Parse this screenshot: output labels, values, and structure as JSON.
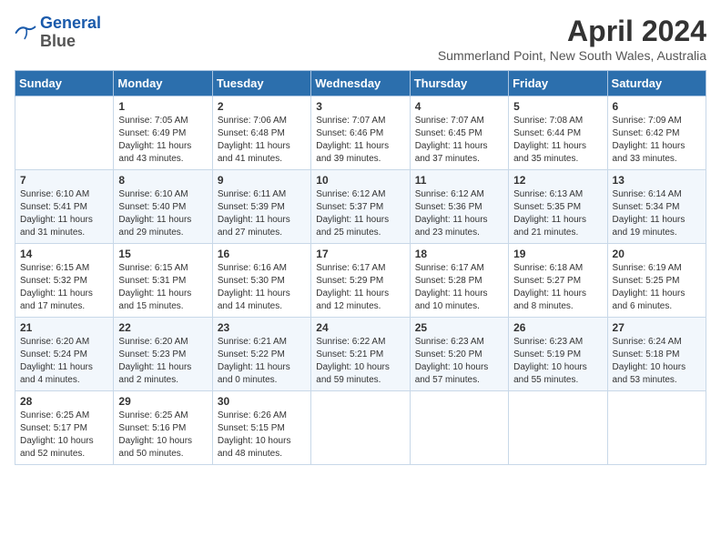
{
  "logo": {
    "line1": "General",
    "line2": "Blue"
  },
  "title": "April 2024",
  "location": "Summerland Point, New South Wales, Australia",
  "weekdays": [
    "Sunday",
    "Monday",
    "Tuesday",
    "Wednesday",
    "Thursday",
    "Friday",
    "Saturday"
  ],
  "weeks": [
    [
      {
        "day": "",
        "content": ""
      },
      {
        "day": "1",
        "content": "Sunrise: 7:05 AM\nSunset: 6:49 PM\nDaylight: 11 hours\nand 43 minutes."
      },
      {
        "day": "2",
        "content": "Sunrise: 7:06 AM\nSunset: 6:48 PM\nDaylight: 11 hours\nand 41 minutes."
      },
      {
        "day": "3",
        "content": "Sunrise: 7:07 AM\nSunset: 6:46 PM\nDaylight: 11 hours\nand 39 minutes."
      },
      {
        "day": "4",
        "content": "Sunrise: 7:07 AM\nSunset: 6:45 PM\nDaylight: 11 hours\nand 37 minutes."
      },
      {
        "day": "5",
        "content": "Sunrise: 7:08 AM\nSunset: 6:44 PM\nDaylight: 11 hours\nand 35 minutes."
      },
      {
        "day": "6",
        "content": "Sunrise: 7:09 AM\nSunset: 6:42 PM\nDaylight: 11 hours\nand 33 minutes."
      }
    ],
    [
      {
        "day": "7",
        "content": "Sunrise: 6:10 AM\nSunset: 5:41 PM\nDaylight: 11 hours\nand 31 minutes."
      },
      {
        "day": "8",
        "content": "Sunrise: 6:10 AM\nSunset: 5:40 PM\nDaylight: 11 hours\nand 29 minutes."
      },
      {
        "day": "9",
        "content": "Sunrise: 6:11 AM\nSunset: 5:39 PM\nDaylight: 11 hours\nand 27 minutes."
      },
      {
        "day": "10",
        "content": "Sunrise: 6:12 AM\nSunset: 5:37 PM\nDaylight: 11 hours\nand 25 minutes."
      },
      {
        "day": "11",
        "content": "Sunrise: 6:12 AM\nSunset: 5:36 PM\nDaylight: 11 hours\nand 23 minutes."
      },
      {
        "day": "12",
        "content": "Sunrise: 6:13 AM\nSunset: 5:35 PM\nDaylight: 11 hours\nand 21 minutes."
      },
      {
        "day": "13",
        "content": "Sunrise: 6:14 AM\nSunset: 5:34 PM\nDaylight: 11 hours\nand 19 minutes."
      }
    ],
    [
      {
        "day": "14",
        "content": "Sunrise: 6:15 AM\nSunset: 5:32 PM\nDaylight: 11 hours\nand 17 minutes."
      },
      {
        "day": "15",
        "content": "Sunrise: 6:15 AM\nSunset: 5:31 PM\nDaylight: 11 hours\nand 15 minutes."
      },
      {
        "day": "16",
        "content": "Sunrise: 6:16 AM\nSunset: 5:30 PM\nDaylight: 11 hours\nand 14 minutes."
      },
      {
        "day": "17",
        "content": "Sunrise: 6:17 AM\nSunset: 5:29 PM\nDaylight: 11 hours\nand 12 minutes."
      },
      {
        "day": "18",
        "content": "Sunrise: 6:17 AM\nSunset: 5:28 PM\nDaylight: 11 hours\nand 10 minutes."
      },
      {
        "day": "19",
        "content": "Sunrise: 6:18 AM\nSunset: 5:27 PM\nDaylight: 11 hours\nand 8 minutes."
      },
      {
        "day": "20",
        "content": "Sunrise: 6:19 AM\nSunset: 5:25 PM\nDaylight: 11 hours\nand 6 minutes."
      }
    ],
    [
      {
        "day": "21",
        "content": "Sunrise: 6:20 AM\nSunset: 5:24 PM\nDaylight: 11 hours\nand 4 minutes."
      },
      {
        "day": "22",
        "content": "Sunrise: 6:20 AM\nSunset: 5:23 PM\nDaylight: 11 hours\nand 2 minutes."
      },
      {
        "day": "23",
        "content": "Sunrise: 6:21 AM\nSunset: 5:22 PM\nDaylight: 11 hours\nand 0 minutes."
      },
      {
        "day": "24",
        "content": "Sunrise: 6:22 AM\nSunset: 5:21 PM\nDaylight: 10 hours\nand 59 minutes."
      },
      {
        "day": "25",
        "content": "Sunrise: 6:23 AM\nSunset: 5:20 PM\nDaylight: 10 hours\nand 57 minutes."
      },
      {
        "day": "26",
        "content": "Sunrise: 6:23 AM\nSunset: 5:19 PM\nDaylight: 10 hours\nand 55 minutes."
      },
      {
        "day": "27",
        "content": "Sunrise: 6:24 AM\nSunset: 5:18 PM\nDaylight: 10 hours\nand 53 minutes."
      }
    ],
    [
      {
        "day": "28",
        "content": "Sunrise: 6:25 AM\nSunset: 5:17 PM\nDaylight: 10 hours\nand 52 minutes."
      },
      {
        "day": "29",
        "content": "Sunrise: 6:25 AM\nSunset: 5:16 PM\nDaylight: 10 hours\nand 50 minutes."
      },
      {
        "day": "30",
        "content": "Sunrise: 6:26 AM\nSunset: 5:15 PM\nDaylight: 10 hours\nand 48 minutes."
      },
      {
        "day": "",
        "content": ""
      },
      {
        "day": "",
        "content": ""
      },
      {
        "day": "",
        "content": ""
      },
      {
        "day": "",
        "content": ""
      }
    ]
  ]
}
